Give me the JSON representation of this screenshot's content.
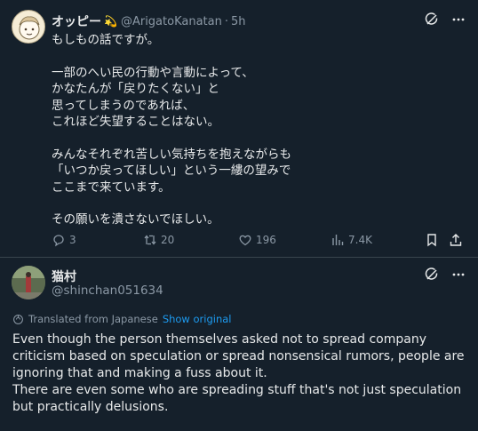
{
  "tweet": {
    "author_name": "オッピー",
    "badge_emoji": "💫",
    "handle": "@ArigatoKanatan",
    "separator": "·",
    "time": "5h",
    "text": "もしもの話ですが。\n\n一部のへい民の行動や言動によって、\nかなたんが「戻りたくない」と\n思ってしまうのであれば、\nこれほど失望することはない。\n\nみんなそれぞれ苦しい気持ちを抱えながらも\n「いつか戻ってほしい」という一縷の望みで\nここまで来ています。\n\nその願いを潰さないでほしい。",
    "actions": {
      "replies": "3",
      "reposts": "20",
      "likes": "196",
      "views": "7.4K"
    }
  },
  "reply": {
    "author_name": "猫村",
    "handle": "@shinchan051634",
    "translated_label": "Translated from Japanese",
    "show_original": "Show original",
    "text": "Even though the person themselves asked not to spread company criticism based on speculation or spread nonsensical rumors, people are ignoring that and making a fuss about it.\nThere are even some who are spreading stuff that's not just speculation but practically delusions."
  },
  "icons": {
    "grok": "grok-icon",
    "more": "more-icon",
    "reply": "reply-icon",
    "repost": "repost-icon",
    "like": "heart-icon",
    "views": "views-icon",
    "bookmark": "bookmark-icon",
    "share": "share-icon",
    "translate": "translate-icon"
  },
  "colors": {
    "background": "#15202b",
    "text": "#e7e9ea",
    "muted": "#8b98a5",
    "link": "#1d9bf0",
    "divider": "#38444d"
  }
}
